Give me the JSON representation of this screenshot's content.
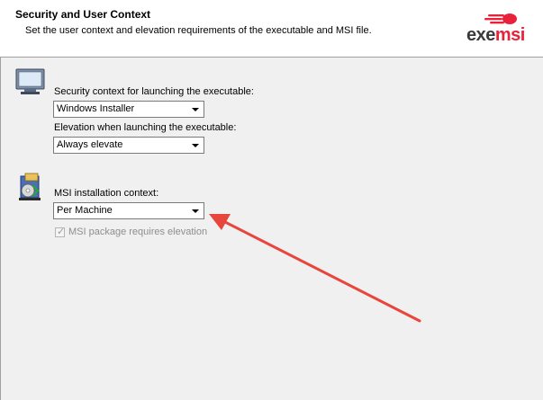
{
  "header": {
    "title": "Security and User Context",
    "subtitle": "Set the user context and elevation requirements of the executable and MSI file.",
    "logo": {
      "text_main": "exe",
      "text_accent": "msi"
    }
  },
  "executable_section": {
    "icon": "monitor-icon",
    "security_context_label": "Security context for launching the executable:",
    "security_context_value": "Windows Installer",
    "elevation_label": "Elevation when launching the executable:",
    "elevation_value": "Always elevate"
  },
  "msi_section": {
    "icon": "installer-package-icon",
    "installation_context_label": "MSI installation context:",
    "installation_context_value": "Per Machine",
    "requires_elevation_label": "MSI package requires elevation",
    "requires_elevation_checked": true
  },
  "colors": {
    "annotation_arrow": "#e8453c",
    "logo_accent": "#e8223a",
    "logo_text": "#3a3a3a"
  }
}
